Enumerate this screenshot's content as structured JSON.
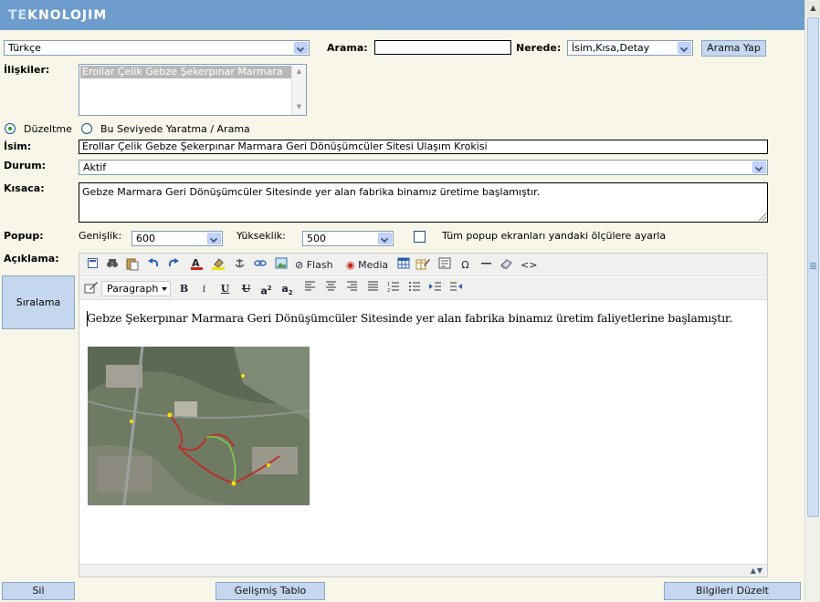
{
  "app": {
    "logo_prefix": "TE",
    "logo_rest": "KNOLOJIM"
  },
  "search_row": {
    "language_value": "Türkçe",
    "arama_label": "Arama:",
    "arama_value": "",
    "nerede_label": "Nerede:",
    "nerede_value": "İsim,Kısa,Detay",
    "search_button": "Arama Yap"
  },
  "relations": {
    "label": "İlişkiler:",
    "items": [
      "Erollar Çelik Gebze Şekerpınar Marmara"
    ]
  },
  "mode": {
    "edit_label": "Düzeltme",
    "create_label": "Bu Seviyede Yaratma / Arama",
    "selected": "edit"
  },
  "form": {
    "name_label": "İsim:",
    "name_value": "Erollar Çelik Gebze Şekerpınar Marmara Geri Dönüşümcüler Sitesi Ulaşım Krokisi",
    "status_label": "Durum:",
    "status_value": "Aktif",
    "short_label": "Kısaca:",
    "short_value": "Gebze Marmara Geri Dönüşümcüler Sitesinde yer alan fabrika binamız üretime başlamıştır.",
    "popup_label": "Popup:",
    "width_label": "Genişlik:",
    "width_value": "600",
    "height_label": "Yükseklik:",
    "height_value": "500",
    "all_popups_label": "Tüm popup ekranları yandaki ölçülere ayarla",
    "all_popups_checked": false,
    "description_label": "Açıklama:"
  },
  "side": {
    "sort_button": "Sıralama"
  },
  "editor": {
    "toolbar1": {
      "flash_label": "Flash",
      "media_label": "Media"
    },
    "toolbar2": {
      "format_value": "Paragraph"
    },
    "content_text": "Gebze Şekerpınar Marmara Geri Dönüşümcüler Sitesinde yer alan fabrika binamız üretim faliyetlerine başlamıştır.",
    "image_name": "aerial-map-image"
  },
  "footer": {
    "delete_button": "Sil",
    "advanced_table_button": "Gelişmiş Tablo",
    "save_button": "Bilgileri Düzelt"
  },
  "colors": {
    "header_bg": "#6e9ccc",
    "page_bg": "#f7f6e8",
    "button_bg": "#c5d7ee"
  }
}
